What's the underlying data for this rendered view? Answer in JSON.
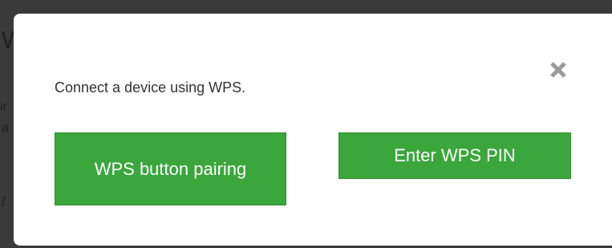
{
  "background": {
    "fragments": [
      "W",
      "ir",
      "a",
      "/"
    ]
  },
  "dialog": {
    "prompt": "Connect a device using WPS.",
    "close_icon": "close-icon",
    "buttons": {
      "wps_button_pairing_label": "WPS button pairing",
      "enter_wps_pin_label": "Enter WPS PIN"
    }
  },
  "colors": {
    "button_green": "#3aa63b",
    "close_icon": "#9a9a9a",
    "backdrop": "#3a3a3a",
    "dialog_bg": "#ffffff"
  }
}
